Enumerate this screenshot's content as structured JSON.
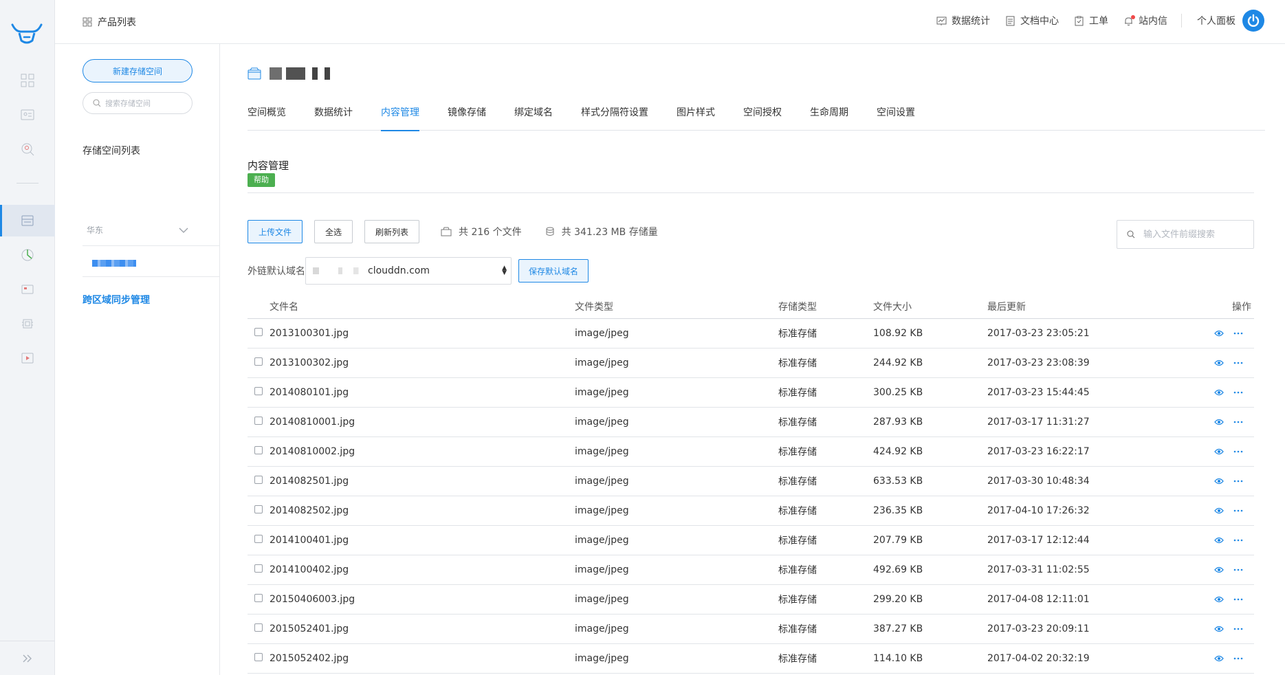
{
  "topbar": {
    "product_list": "产品列表",
    "nav": [
      {
        "label": "数据统计",
        "icon": "chart-icon"
      },
      {
        "label": "文档中心",
        "icon": "document-icon"
      },
      {
        "label": "工单",
        "icon": "ticket-icon"
      },
      {
        "label": "站内信",
        "icon": "bell-icon"
      }
    ],
    "personal_panel": "个人面板"
  },
  "sidebar": {
    "new_bucket": "新建存储空间",
    "search_placeholder": "搜索存储空间",
    "list_title": "存储空间列表",
    "region": "华东",
    "cross_region": "跨区域同步管理"
  },
  "main": {
    "tabs": [
      "空间概览",
      "数据统计",
      "内容管理",
      "镜像存储",
      "绑定域名",
      "样式分隔符设置",
      "图片样式",
      "空间授权",
      "生命周期",
      "空间设置"
    ],
    "active_tab": "内容管理",
    "section_title": "内容管理",
    "help": "帮助",
    "toolbar": {
      "upload": "上传文件",
      "select_all": "全选",
      "refresh": "刷新列表",
      "file_count": "共 216 个文件",
      "storage": "共 341.23 MB 存储量"
    },
    "search_placeholder": "输入文件前缀搜索",
    "domain": {
      "label": "外链默认域名",
      "value": "clouddn.com",
      "save": "保存默认域名"
    },
    "table": {
      "headers": [
        "文件名",
        "文件类型",
        "存储类型",
        "文件大小",
        "最后更新",
        "操作"
      ],
      "rows": [
        {
          "name": "2013100301.jpg",
          "type": "image/jpeg",
          "storage": "标准存储",
          "size": "108.92 KB",
          "updated": "2017-03-23 23:05:21"
        },
        {
          "name": "2013100302.jpg",
          "type": "image/jpeg",
          "storage": "标准存储",
          "size": "244.92 KB",
          "updated": "2017-03-23 23:08:39"
        },
        {
          "name": "2014080101.jpg",
          "type": "image/jpeg",
          "storage": "标准存储",
          "size": "300.25 KB",
          "updated": "2017-03-23 15:44:45"
        },
        {
          "name": "20140810001.jpg",
          "type": "image/jpeg",
          "storage": "标准存储",
          "size": "287.93 KB",
          "updated": "2017-03-17 11:31:27"
        },
        {
          "name": "20140810002.jpg",
          "type": "image/jpeg",
          "storage": "标准存储",
          "size": "424.92 KB",
          "updated": "2017-03-23 16:22:17"
        },
        {
          "name": "2014082501.jpg",
          "type": "image/jpeg",
          "storage": "标准存储",
          "size": "633.53 KB",
          "updated": "2017-03-30 10:48:34"
        },
        {
          "name": "2014082502.jpg",
          "type": "image/jpeg",
          "storage": "标准存储",
          "size": "236.35 KB",
          "updated": "2017-04-10 17:26:32"
        },
        {
          "name": "2014100401.jpg",
          "type": "image/jpeg",
          "storage": "标准存储",
          "size": "207.79 KB",
          "updated": "2017-03-17 12:12:44"
        },
        {
          "name": "2014100402.jpg",
          "type": "image/jpeg",
          "storage": "标准存储",
          "size": "492.69 KB",
          "updated": "2017-03-31 11:02:55"
        },
        {
          "name": "20150406003.jpg",
          "type": "image/jpeg",
          "storage": "标准存储",
          "size": "299.20 KB",
          "updated": "2017-04-08 12:11:01"
        },
        {
          "name": "2015052401.jpg",
          "type": "image/jpeg",
          "storage": "标准存储",
          "size": "387.27 KB",
          "updated": "2017-03-23 20:09:11"
        },
        {
          "name": "2015052402.jpg",
          "type": "image/jpeg",
          "storage": "标准存储",
          "size": "114.10 KB",
          "updated": "2017-04-02 20:32:19"
        }
      ]
    }
  },
  "colors": {
    "accent": "#1e88e5",
    "help_green": "#4caf50",
    "rail_bg": "#f2f4f7"
  }
}
